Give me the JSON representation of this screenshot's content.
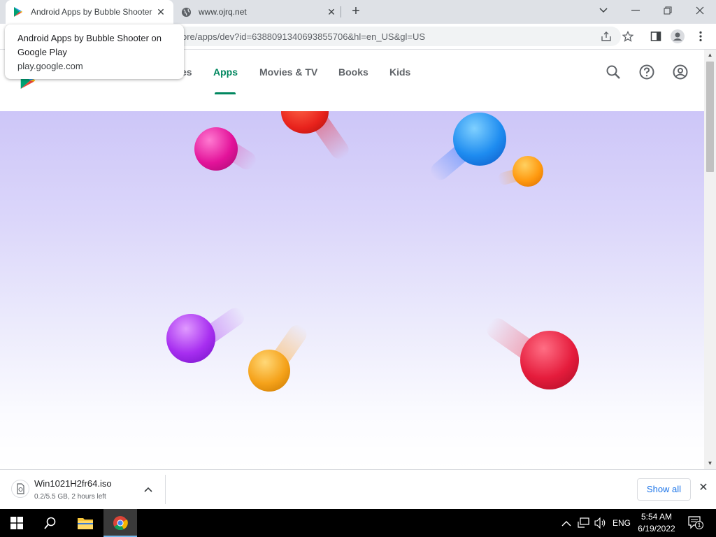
{
  "browser": {
    "tabs": [
      {
        "title": "Android Apps by Bubble Shooter",
        "active": true
      },
      {
        "title": "www.ojrq.net",
        "active": false
      }
    ],
    "url": "ore/apps/dev?id=6388091340693855706&hl=en_US&gl=US",
    "tooltip": {
      "title": "Android Apps by Bubble Shooter on Google Play",
      "domain": "play.google.com"
    }
  },
  "play_nav": {
    "partial_label": "es",
    "links": [
      "Apps",
      "Movies & TV",
      "Books",
      "Kids"
    ],
    "active": "Apps"
  },
  "download": {
    "filename": "Win1021H2fr64.iso",
    "status": "0.2/5.5 GB, 2 hours left",
    "show_all": "Show all"
  },
  "taskbar": {
    "language": "ENG",
    "time": "5:54 AM",
    "date": "6/19/2022",
    "notification_count": "1"
  },
  "colors": {
    "play_green": "#01875f",
    "link_blue": "#1a73e8",
    "banner_top": "#cdc6f8"
  }
}
